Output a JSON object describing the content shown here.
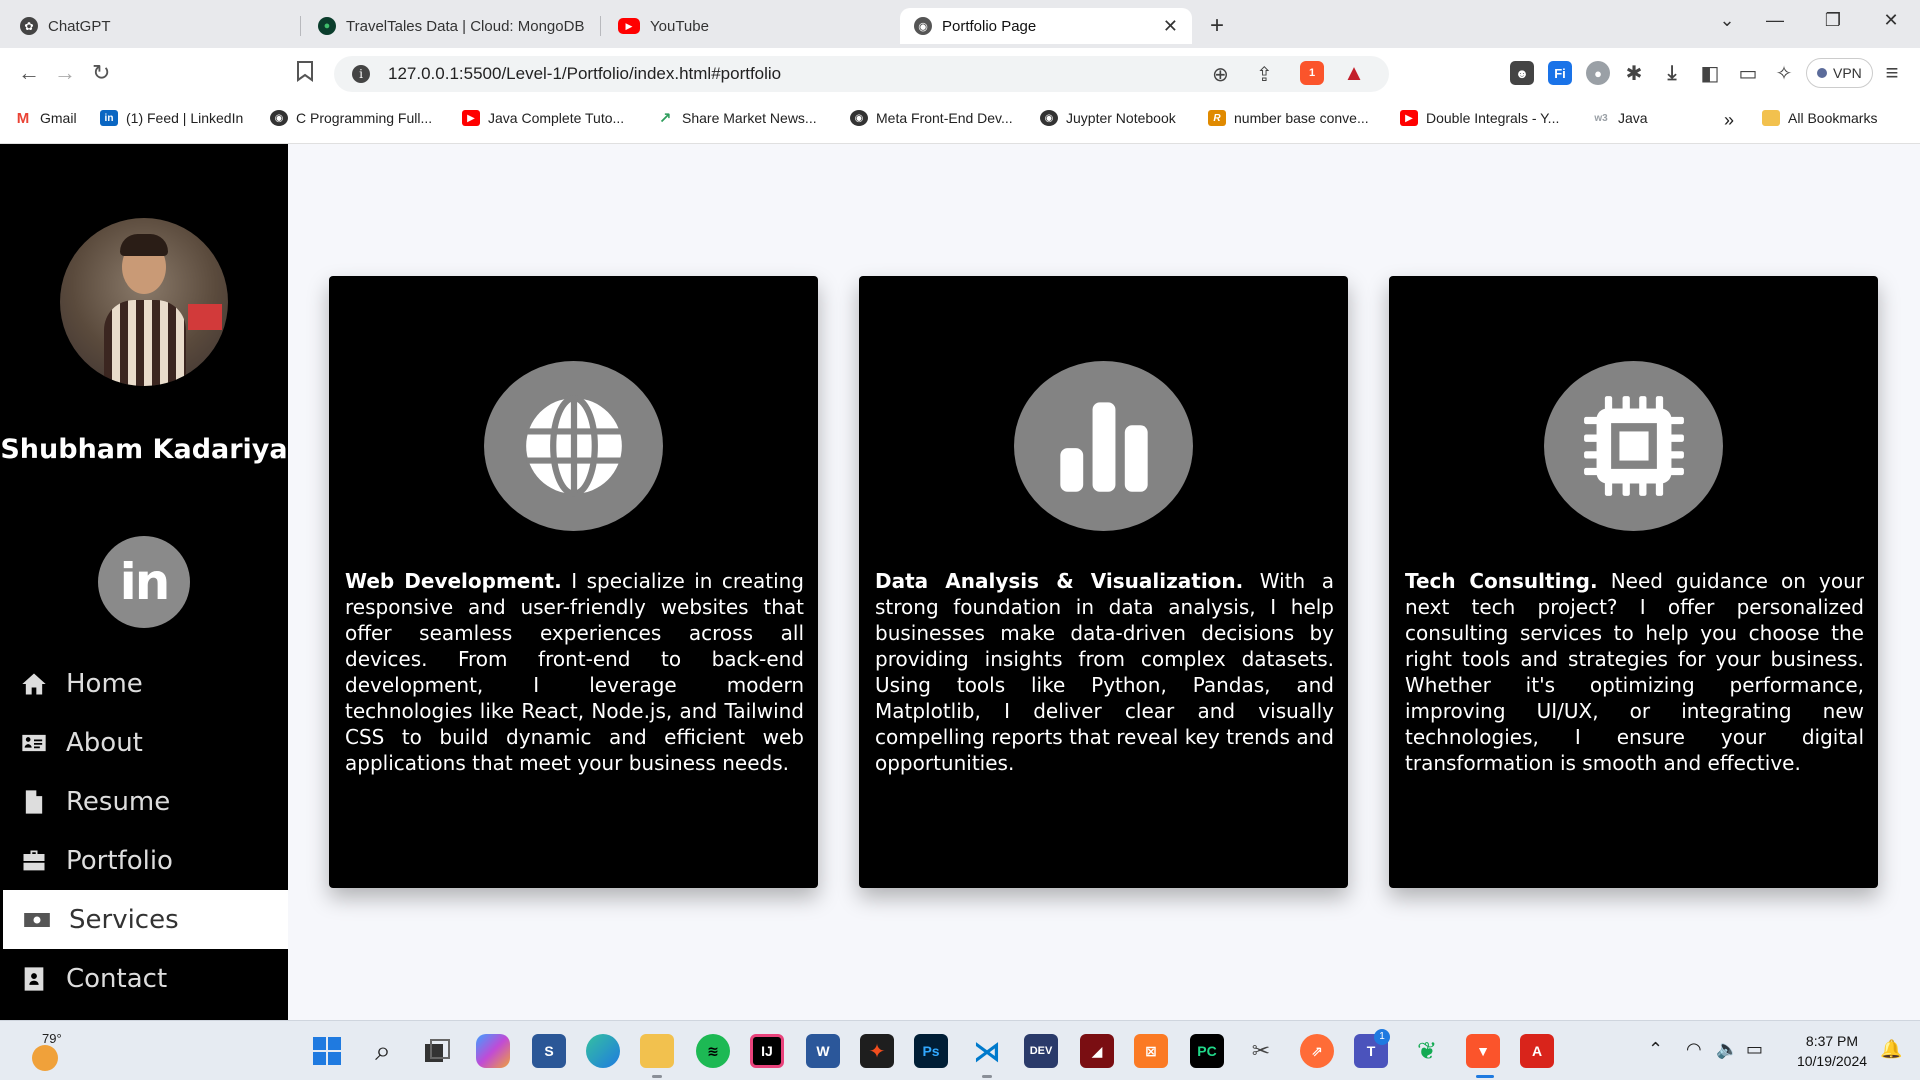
{
  "tabs": [
    {
      "title": "ChatGPT",
      "icon": "chatgpt-icon",
      "active": false
    },
    {
      "title": "TravelTales Data | Cloud: MongoDB",
      "icon": "mongodb-icon",
      "active": false
    },
    {
      "title": "YouTube",
      "icon": "youtube-icon",
      "active": false
    },
    {
      "title": "Portfolio Page",
      "icon": "globe-icon",
      "active": true
    }
  ],
  "address": {
    "url": "127.0.0.1:5500/Level-1/Portfolio/index.html#portfolio"
  },
  "vpn_label": "VPN",
  "brave_badge": "1",
  "bookmarks": [
    {
      "label": "Gmail",
      "icon": "gmail-icon",
      "color": "#ea4335",
      "glyph": "M"
    },
    {
      "label": "(1) Feed | LinkedIn",
      "icon": "linkedin-icon",
      "color": "#0a66c2",
      "glyph": "in"
    },
    {
      "label": "C Programming Full...",
      "icon": "globe-icon",
      "color": "#333333",
      "glyph": "◉"
    },
    {
      "label": "Java Complete Tuto...",
      "icon": "youtube-icon",
      "color": "#ff0000",
      "glyph": "▶"
    },
    {
      "label": "Share Market News...",
      "icon": "chart-icon",
      "color": "#2e9d5c",
      "glyph": "↗"
    },
    {
      "label": "Meta Front-End Dev...",
      "icon": "globe-icon",
      "color": "#333333",
      "glyph": "◉"
    },
    {
      "label": "Juypter Notebook",
      "icon": "globe-icon",
      "color": "#333333",
      "glyph": "◉"
    },
    {
      "label": "number base conve...",
      "icon": "rapidtables-icon",
      "color": "#e08a00",
      "glyph": "R"
    },
    {
      "label": "Double Integrals - Y...",
      "icon": "youtube-icon",
      "color": "#ff0000",
      "glyph": "▶"
    },
    {
      "label": "Java",
      "icon": "w3schools-icon",
      "color": "#9aa0a6",
      "glyph": "w3"
    }
  ],
  "all_bookmarks": "All Bookmarks",
  "profile": {
    "name": "Shubham Kadariya",
    "linkedin_label": "in"
  },
  "nav": [
    {
      "label": "Home",
      "icon": "home-icon",
      "active": false
    },
    {
      "label": "About",
      "icon": "id-card-icon",
      "active": false
    },
    {
      "label": "Resume",
      "icon": "file-icon",
      "active": false
    },
    {
      "label": "Portfolio",
      "icon": "briefcase-icon",
      "active": false
    },
    {
      "label": "Services",
      "icon": "money-bill-icon",
      "active": true
    },
    {
      "label": "Contact",
      "icon": "address-book-icon",
      "active": false
    }
  ],
  "services": [
    {
      "icon": "globe-icon",
      "title": "Web Development.",
      "text": "I specialize in creating responsive and user-friendly websites that offer seamless experiences across all devices. From front-end to back-end development, I leverage modern technologies like React, Node.js, and Tailwind CSS to build dynamic and efficient web applications that meet your business needs."
    },
    {
      "icon": "bar-chart-icon",
      "title": "Data Analysis & Visualization.",
      "text": "With a strong foundation in data analysis, I help businesses make data-driven decisions by providing insights from complex datasets. Using tools like Python, Pandas, and Matplotlib, I deliver clear and visually compelling reports that reveal key trends and opportunities."
    },
    {
      "icon": "microchip-icon",
      "title": "Tech Consulting.",
      "text": "Need guidance on your next tech project? I offer personalized consulting services to help you choose the right tools and strategies for your business. Whether it's optimizing performance, improving UI/UX, or integrating new technologies, I ensure your digital transformation is smooth and effective."
    }
  ],
  "taskbar": {
    "weather": "79°",
    "teams_badge": "1",
    "time": "8:37 PM",
    "date": "10/19/2024"
  },
  "colors": {
    "sidebar": "#000000",
    "card": "#000000",
    "icon_circle": "#838383",
    "page_bg": "#f6f7fb"
  }
}
